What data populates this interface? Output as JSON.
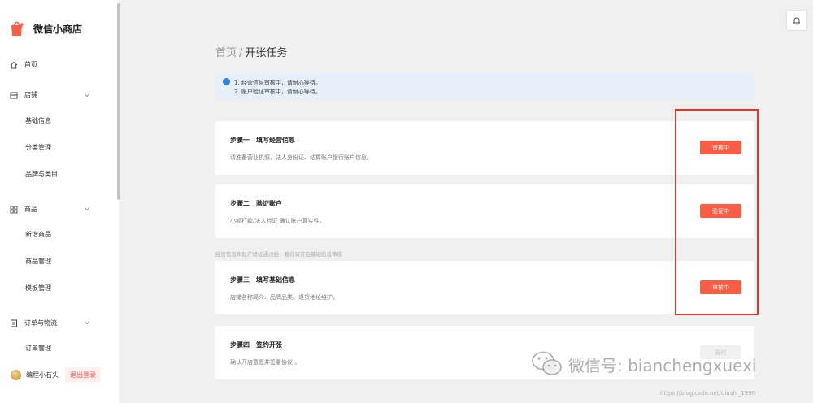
{
  "app": {
    "title": "微信小商店"
  },
  "sidebar": {
    "home": "首页",
    "shop": {
      "label": "店铺",
      "items": [
        "基础信息",
        "分类管理",
        "品牌与类目"
      ]
    },
    "goods": {
      "label": "商品",
      "items": [
        "新增商品",
        "商品管理",
        "模板管理"
      ]
    },
    "orders": {
      "label": "订单与物流",
      "items": [
        "订单管理"
      ]
    },
    "user": {
      "name": "编程小石头",
      "logout": "退出登录"
    }
  },
  "breadcrumb": {
    "home": "首页",
    "separator": "/",
    "current": "开张任务"
  },
  "notice": {
    "line1": "1. 经营信息审核中，请耐心等待。",
    "line2": "2. 账户验证审核中，请耐心等待。"
  },
  "steps": [
    {
      "title": "步骤一　填写经营信息",
      "desc": "请准备营业执照、法人身份证、结算账户银行账户信息。",
      "button": "审核中"
    },
    {
      "title": "步骤二　验证账户",
      "desc": "小额打款/法人验证 确认账户真实性。",
      "button": "验证中"
    },
    {
      "title": "步骤三　填写基础信息",
      "desc": "店铺名称简介、品牌品类、退货地址维护。",
      "button": "审核中"
    },
    {
      "title": "步骤四　签约开张",
      "desc": "确认开店意愿并签署协议 。",
      "button": "签约"
    }
  ],
  "tip": "经营信息和账户验证通过后，我们将开启基础信息审核",
  "watermark": {
    "text": "微信号: bianchengxuexi",
    "url": "https://blog.csdn.net/qiushi_1990"
  },
  "colors": {
    "accent": "#fa5d43",
    "highlight": "#e8322c",
    "notice_bg": "#e6effa",
    "info_dot": "#2a82e4"
  }
}
